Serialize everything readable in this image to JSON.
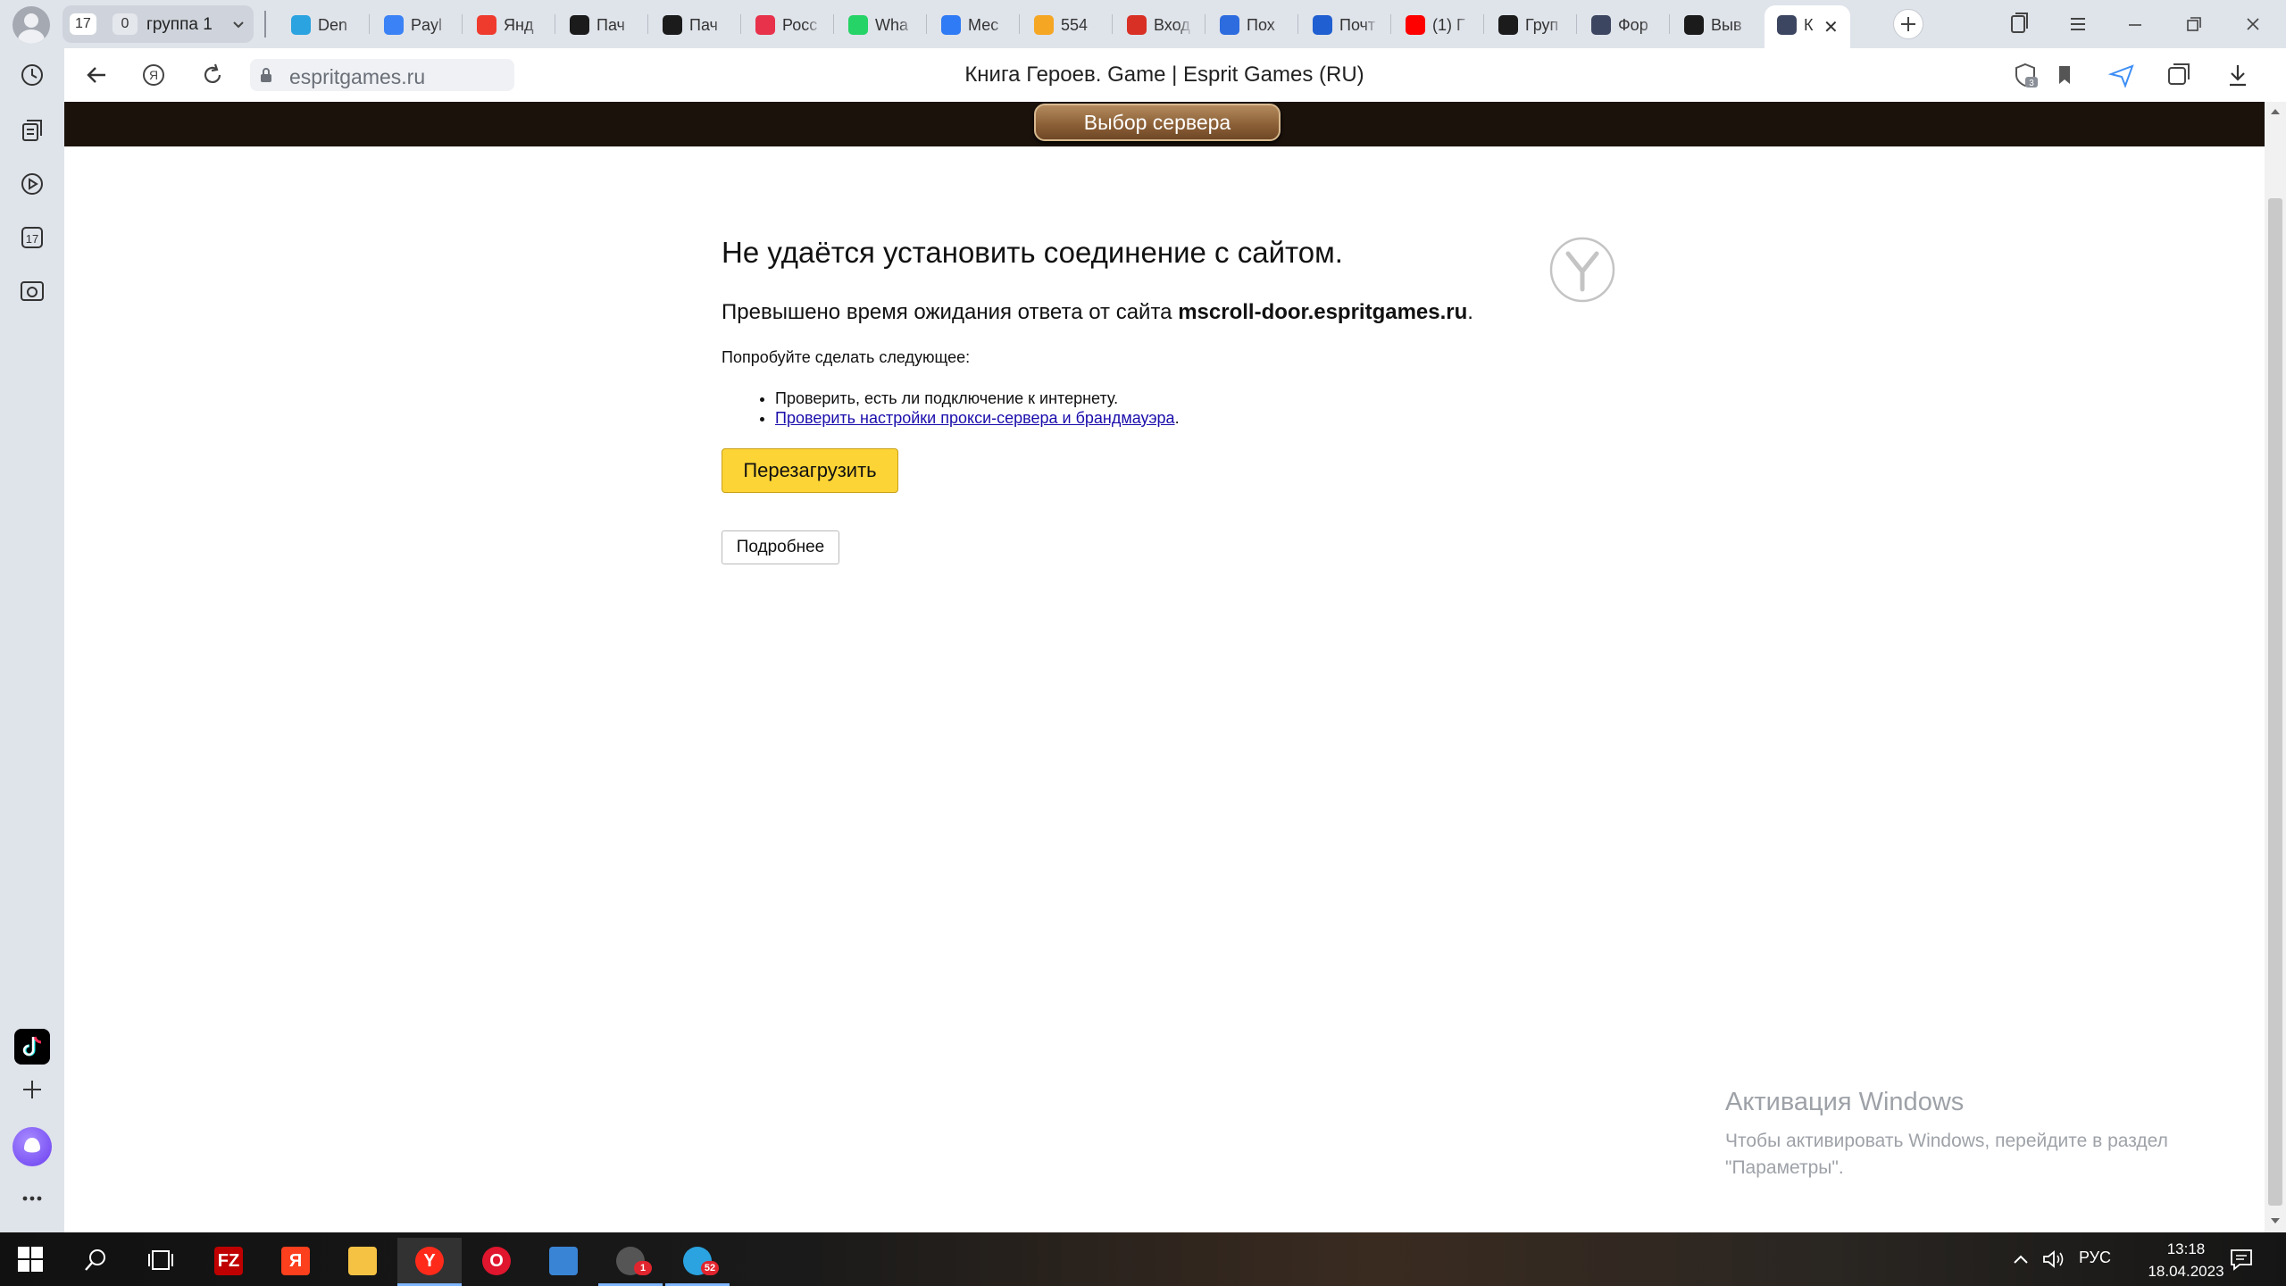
{
  "browser": {
    "tab_group": {
      "count": "17",
      "zero": "0",
      "name": "группа 1"
    },
    "tabs": [
      {
        "title": "Den",
        "icon": "telegram-icon",
        "color": "#2aa3e0"
      },
      {
        "title": "Payl",
        "icon": "mail-icon",
        "color": "#3b82f6"
      },
      {
        "title": "Янд",
        "icon": "maps-pin-icon",
        "color": "#ef3b2d"
      },
      {
        "title": "Пач",
        "icon": "layers-icon",
        "color": "#1b1b1b"
      },
      {
        "title": "Пач",
        "icon": "layers-icon",
        "color": "#1b1b1b"
      },
      {
        "title": "Росс",
        "icon": "ya-icon",
        "color": "#e8314b"
      },
      {
        "title": "Wha",
        "icon": "whatsapp-icon",
        "color": "#25d366"
      },
      {
        "title": "Мес",
        "icon": "badge-one-icon",
        "color": "#2f7bf5"
      },
      {
        "title": "554",
        "icon": "envelope-icon",
        "color": "#f5a623"
      },
      {
        "title": "Вход",
        "icon": "gmail-icon",
        "color": "#d93025"
      },
      {
        "title": "Пох",
        "icon": "at-icon",
        "color": "#2d6cdf"
      },
      {
        "title": "Почт",
        "icon": "mailbox-icon",
        "color": "#1f5fd1"
      },
      {
        "title": "(1) Г",
        "icon": "youtube-icon",
        "color": "#ff0000"
      },
      {
        "title": "Груп",
        "icon": "do-icon",
        "color": "#1b1b1b"
      },
      {
        "title": "Фор",
        "icon": "star-icon",
        "color": "#3c4660"
      },
      {
        "title": "Выв",
        "icon": "do-icon",
        "color": "#1b1b1b"
      },
      {
        "title": "К",
        "icon": "star-icon",
        "color": "#3c4660",
        "active": true
      }
    ],
    "address": {
      "url": "espritgames.ru"
    },
    "page_title": "Книга Героев. Game | Esprit Games (RU)",
    "protect_badge": "3"
  },
  "page": {
    "server_button": "Выбор сервера",
    "error_title": "Не удаётся установить соединение с сайтом.",
    "error_desc_prefix": "Превышено время ожидания ответа от сайта ",
    "error_host": "mscroll-door.espritgames.ru",
    "error_desc_suffix": ".",
    "try_heading": "Попробуйте сделать следующее:",
    "tip_1": "Проверить, есть ли подключение к интернету.",
    "tip_2_link": "Проверить настройки прокси-сервера и брандмауэра",
    "tip_2_suffix": ".",
    "reload_label": "Перезагрузить",
    "details_label": "Подробнее"
  },
  "watermark": {
    "title": "Активация Windows",
    "text": "Чтобы активировать Windows, перейдите в раздел \"Параметры\"."
  },
  "sidebar": {
    "calendar_day": "17"
  },
  "taskbar": {
    "apps": [
      {
        "name": "filezilla",
        "icon": "filezilla-icon",
        "color": "#bf0000",
        "glyph": "FZ"
      },
      {
        "name": "yandex",
        "icon": "yandex-icon",
        "color": "#fc3f1d",
        "glyph": "Я"
      },
      {
        "name": "explorer",
        "icon": "folder-icon",
        "color": "#f6c244",
        "glyph": ""
      },
      {
        "name": "yandex-browser",
        "icon": "yandex-browser-icon",
        "color": "#ff2a1a",
        "glyph": "Y"
      },
      {
        "name": "opera",
        "icon": "opera-icon",
        "color": "#e0152e",
        "glyph": "O"
      },
      {
        "name": "app-6",
        "icon": "laptop-icon",
        "color": "#3a84d6",
        "glyph": ""
      },
      {
        "name": "app-7",
        "icon": "chat-icon",
        "color": "#555",
        "glyph": "",
        "badge": "1"
      },
      {
        "name": "telegram",
        "icon": "telegram-icon",
        "color": "#2aa3e0",
        "glyph": "",
        "badge": "52"
      }
    ],
    "lang": "РУС",
    "time": "13:18",
    "date": "18.04.2023"
  },
  "colors": {
    "accent_yellow": "#fdd435",
    "link": "#1a0dab",
    "game_strip": "#1b120c"
  }
}
